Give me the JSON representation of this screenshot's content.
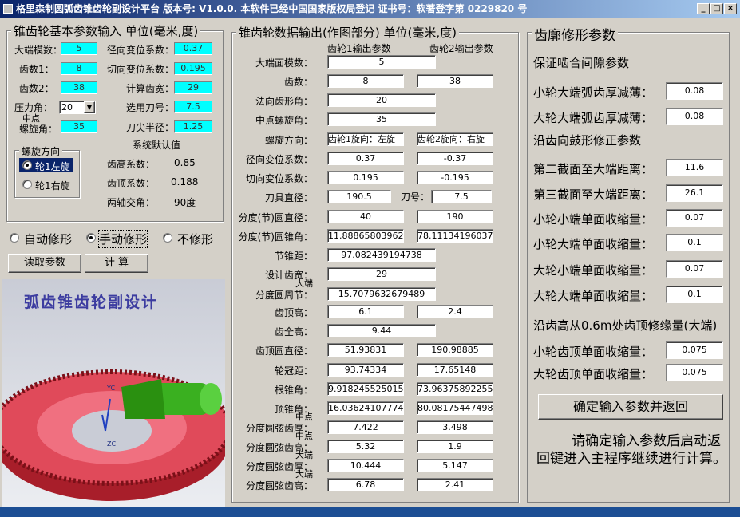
{
  "window": {
    "title": "格里森制圆弧齿锥齿轮副设计平台  版本号: V1.0.0.  本软件已经中国国家版权局登记  证书号：软著登字第 0229820 号",
    "min": "_",
    "max": "□",
    "close": "×"
  },
  "left": {
    "title": "锥齿轮基本参数输入 单位(毫米,度)",
    "big_module_label": "大端模数：",
    "big_module": "5",
    "teeth1_label": "齿数1：",
    "teeth1": "8",
    "teeth2_label": "齿数2：",
    "teeth2": "38",
    "pressure_label": "压力角：",
    "pressure": "20",
    "helix_label_1": "中点",
    "helix_label_2": "螺旋角：",
    "helix": "35",
    "radial_shift_label": "径向变位系数：",
    "radial_shift": "0.37",
    "tangent_shift_label": "切向变位系数：",
    "tangent_shift": "0.195",
    "calc_width_label": "计算齿宽：",
    "calc_width": "29",
    "cutter_label": "选用刀号：",
    "cutter": "7.5",
    "tip_radius_label": "刀尖半径：",
    "tip_radius": "1.25",
    "sys_default": "系统默认值",
    "addendum_label": "齿高系数：",
    "addendum": "0.85",
    "clearance_label": "齿顶系数：",
    "clearance": "0.188",
    "shaft_label": "两轴交角：",
    "shaft": "90度",
    "dir_title": "螺旋方向",
    "dir_left": "轮1左旋",
    "dir_right": "轮1右旋",
    "mod_auto": "自动修形",
    "mod_manual": "手动修形",
    "mod_none": "不修形",
    "read_btn": "读取参数",
    "calc_btn": "计  算",
    "banner": "弧齿锥齿轮副设计",
    "axis_yc": "YC",
    "axis_zc": "ZC"
  },
  "middle": {
    "title": "锥齿轮数据输出(作图部分) 单位(毫米,度)",
    "h1": "齿轮1输出参数",
    "h2": "齿轮2输出参数",
    "rows": [
      {
        "l1": "",
        "l2": "大端面模数：",
        "v1": "5",
        "v2": null
      },
      {
        "l1": "",
        "l2": "齿数：",
        "v1": "8",
        "v2": "38"
      },
      {
        "l1": "",
        "l2": "法向齿形角：",
        "v1": "20",
        "v2": null
      },
      {
        "l1": "",
        "l2": "中点螺旋角：",
        "v1": "35",
        "v2": null
      },
      {
        "l1": "",
        "l2": "螺旋方向：",
        "v1": "齿轮1旋向：左旋",
        "v2": "齿轮2旋向：右旋"
      },
      {
        "l1": "",
        "l2": "径向变位系数：",
        "v1": "0.37",
        "v2": "-0.37"
      },
      {
        "l1": "",
        "l2": "切向变位系数：",
        "v1": "0.195",
        "v2": "-0.195"
      },
      {
        "l1": "",
        "l2": "刀具直径：",
        "v1": "190.5",
        "v2": "7.5"
      },
      {
        "l1": "",
        "l2": "分度(节)圆直径：",
        "v1": "40",
        "v2": "190"
      },
      {
        "l1": "",
        "l2": "分度(节)圆锥角：",
        "v1": "11.888658039628",
        "v2": "78.111341960372"
      },
      {
        "l1": "",
        "l2": "节锥距：",
        "v1": "97.082439194738",
        "v2": null
      },
      {
        "l1": "",
        "l2": "设计齿宽：",
        "v1": "29",
        "v2": null
      },
      {
        "l1": "大端",
        "l2": "分度圆周节：",
        "v1": "15.7079632679489",
        "v2": null
      },
      {
        "l1": "",
        "l2": "齿顶高：",
        "v1": "6.1",
        "v2": "2.4"
      },
      {
        "l1": "",
        "l2": "齿全高：",
        "v1": "9.44",
        "v2": null
      },
      {
        "l1": "",
        "l2": "齿顶圆直径：",
        "v1": "51.93831",
        "v2": "190.98885"
      },
      {
        "l1": "",
        "l2": "轮冠距：",
        "v1": "93.74334",
        "v2": "17.65148"
      },
      {
        "l1": "",
        "l2": "根锥角：",
        "v1": "9.918245525015€",
        "v2": "73.963758922555"
      },
      {
        "l1": "",
        "l2": "顶锥角：",
        "v1": "16.036241077744",
        "v2": "80.081754474984"
      },
      {
        "l1": "中点",
        "l2": "分度圆弦齿厚：",
        "v1": "7.422",
        "v2": "3.498"
      },
      {
        "l1": "中点",
        "l2": "分度圆弦齿高：",
        "v1": "5.32",
        "v2": "1.9"
      },
      {
        "l1": "大端",
        "l2": "分度圆弦齿厚：",
        "v1": "10.444",
        "v2": "5.147"
      },
      {
        "l1": "大端",
        "l2": "分度圆弦齿高：",
        "v1": "6.78",
        "v2": "2.41"
      }
    ],
    "cutter_no_label": "刀号："
  },
  "right": {
    "title": "齿廓修形参数",
    "sec1": "保证啮合间隙参数",
    "rows": [
      {
        "label": "小轮大端弧齿厚减薄：",
        "value": "0.08"
      },
      {
        "label": "大轮大端弧齿厚减薄：",
        "value": "0.08"
      },
      {
        "label": "第二截面至大端距离：",
        "value": "11.6"
      },
      {
        "label": "第三截面至大端距离：",
        "value": "26.1"
      },
      {
        "label": "小轮小端单面收缩量：",
        "value": "0.07"
      },
      {
        "label": "小轮大端单面收缩量：",
        "value": "0.1"
      },
      {
        "label": "大轮小端单面收缩量：",
        "value": "0.07"
      },
      {
        "label": "大轮大端单面收缩量：",
        "value": "0.1"
      },
      {
        "label": "小轮齿顶单面收缩量：",
        "value": "0.075"
      },
      {
        "label": "大轮齿顶单面收缩量：",
        "value": "0.075"
      }
    ],
    "sec2": "沿齿向鼓形修正参数",
    "sec3": "沿齿高从0.6m处齿顶修缘量(大端)",
    "confirm_btn": "确定输入参数并返回",
    "note": "请确定输入参数后启动返回键进入主程序继续进行计算。"
  }
}
